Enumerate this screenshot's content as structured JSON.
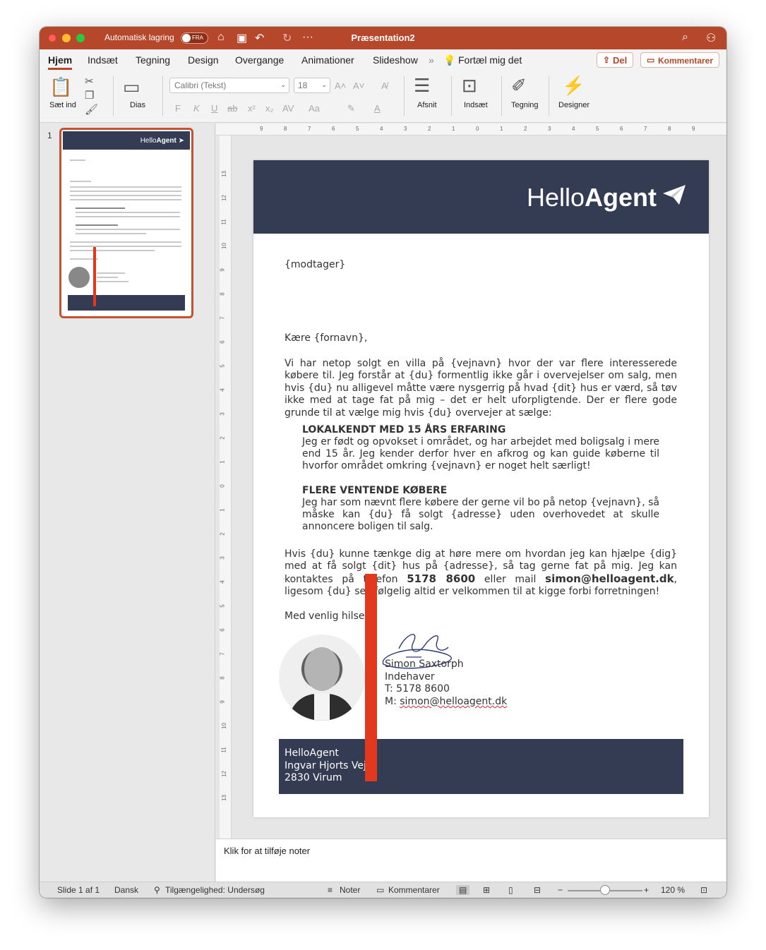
{
  "window": {
    "title": "Præsentation2",
    "autosave_label": "Automatisk lagring",
    "autosave_state": "FRA"
  },
  "tabs": [
    "Hjem",
    "Indsæt",
    "Tegning",
    "Design",
    "Overgange",
    "Animationer",
    "Slideshow"
  ],
  "active_tab": "Hjem",
  "tell_me": "Fortæl mig det",
  "share_label": "Del",
  "comments_label": "Kommentarer",
  "ribbon": {
    "paste_label": "Sæt ind",
    "slide_label": "Dias",
    "font_name": "Calibri (Tekst)",
    "font_size": "18",
    "paragraph_label": "Afsnit",
    "insert_label": "Indsæt",
    "drawing_label": "Tegning",
    "designer_label": "Designer",
    "format_buttons": [
      "F",
      "K",
      "U",
      "ab",
      "x²",
      "x₂",
      "AV",
      "Aa"
    ]
  },
  "thumbnails": {
    "slide_number": "1"
  },
  "ruler": {
    "horizontal": [
      "9",
      "8",
      "7",
      "6",
      "5",
      "4",
      "3",
      "2",
      "1",
      "0",
      "1",
      "2",
      "3",
      "4",
      "5",
      "6",
      "7",
      "8",
      "9"
    ],
    "vertical": [
      "13",
      "12",
      "11",
      "10",
      "9",
      "8",
      "7",
      "6",
      "5",
      "4",
      "3",
      "2",
      "1",
      "0",
      "1",
      "2",
      "3",
      "4",
      "5",
      "6",
      "7",
      "8",
      "9",
      "10",
      "11",
      "12",
      "13"
    ]
  },
  "slide": {
    "logo_light": "Hello",
    "logo_bold": "Agent",
    "recipient": "{modtager}",
    "greeting": "Kære {fornavn},",
    "intro": "Vi har netop solgt en villa på {vejnavn} hvor der var flere interesserede købere til. Jeg forstår at {du} formentlig ikke går i overvejelser om salg, men hvis {du} nu alligevel måtte være nysgerrig på hvad {dit} hus er værd, så tøv ikke med at tage fat på mig – det er helt uforpligtende. Der er flere gode grunde til at vælge mig hvis {du} overvejer at sælge:",
    "point1_title": "LOKALKENDT MED 15 ÅRS ERFARING",
    "point1_text": "Jeg er født og opvokset i området, og har arbejdet med boligsalg i mere end 15 år. Jeg kender derfor hver en afkrog og kan guide køberne til hvorfor området omkring {vejnavn} er noget helt særligt!",
    "point2_title": "FLERE VENTENDE KØBERE",
    "point2_text": "Jeg har som nævnt flere købere der gerne vil bo på netop {vejnavn}, så måske kan {du} få solgt {adresse} uden overhovedet at skulle annoncere boligen til salg.",
    "closing_pre": "Hvis {du} kunne tænkge dig at høre mere om hvordan jeg kan hjælpe {dig} med at få solgt {dit} hus på {adresse}, så tag gerne fat på mig. Jeg kan kontaktes på telefon ",
    "closing_phone": "5178 8600",
    "closing_mid": " eller mail ",
    "closing_email": "simon@helloagent.dk",
    "closing_post": ", ligesom {du} selvfølgelig altid er velkommen til at kigge forbi forretningen!",
    "regards": "Med venlig hilsen",
    "sig_name": "Simon Saxtorph",
    "sig_title": "Indehaver",
    "sig_phone": "T: 5178 8600",
    "sig_mail_prefix": "M: ",
    "sig_mail": "simon@helloagent.dk",
    "footer_company": "HelloAgent",
    "footer_street": "Ingvar Hjorts Vej",
    "footer_city": "2830 Virum"
  },
  "notes_placeholder": "Klik for at tilføje noter",
  "status": {
    "slide_info": "Slide 1 af 1",
    "language": "Dansk",
    "accessibility": "Tilgængelighed: Undersøg",
    "notes_label": "Noter",
    "comments_label": "Kommentarer",
    "zoom": "120 %"
  },
  "colors": {
    "accent": "#b7472a",
    "slide_header": "#343c53",
    "marker_red": "#e2381d"
  }
}
